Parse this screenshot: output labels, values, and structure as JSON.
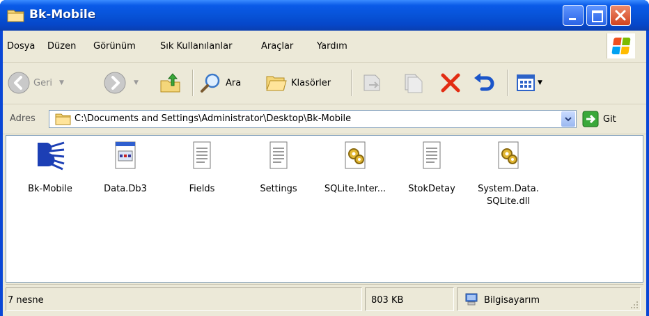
{
  "window": {
    "title": "Bk-Mobile"
  },
  "menu": {
    "items": [
      {
        "label": "Dosya"
      },
      {
        "label": "Düzen"
      },
      {
        "label": "Görünüm"
      },
      {
        "label": "Sık Kullanılanlar"
      },
      {
        "label": "Araçlar"
      },
      {
        "label": "Yardım"
      }
    ]
  },
  "toolbar": {
    "back_label": "Geri",
    "search_label": "Ara",
    "folders_label": "Klasörler"
  },
  "address": {
    "label": "Adres",
    "path": "C:\\Documents and Settings\\Administrator\\Desktop\\Bk-Mobile",
    "go_label": "Git"
  },
  "files": [
    {
      "name": "Bk-Mobile",
      "icon": "bk-mobile-app-icon"
    },
    {
      "name": "Data.Db3",
      "icon": "db-file-icon"
    },
    {
      "name": "Fields",
      "icon": "text-file-icon"
    },
    {
      "name": "Settings",
      "icon": "text-file-icon"
    },
    {
      "name": "SQLite.Inter...",
      "icon": "dll-file-icon"
    },
    {
      "name": "StokDetay",
      "icon": "text-file-icon"
    },
    {
      "name": "System.Data.\nSQLite.dll",
      "icon": "dll-file-icon"
    }
  ],
  "status": {
    "count": "7 nesne",
    "size": "803 KB",
    "location": "Bilgisayarım"
  },
  "colors": {
    "titlebar": "#0753d8",
    "close": "#d2431e",
    "chrome": "#ece9d8"
  }
}
